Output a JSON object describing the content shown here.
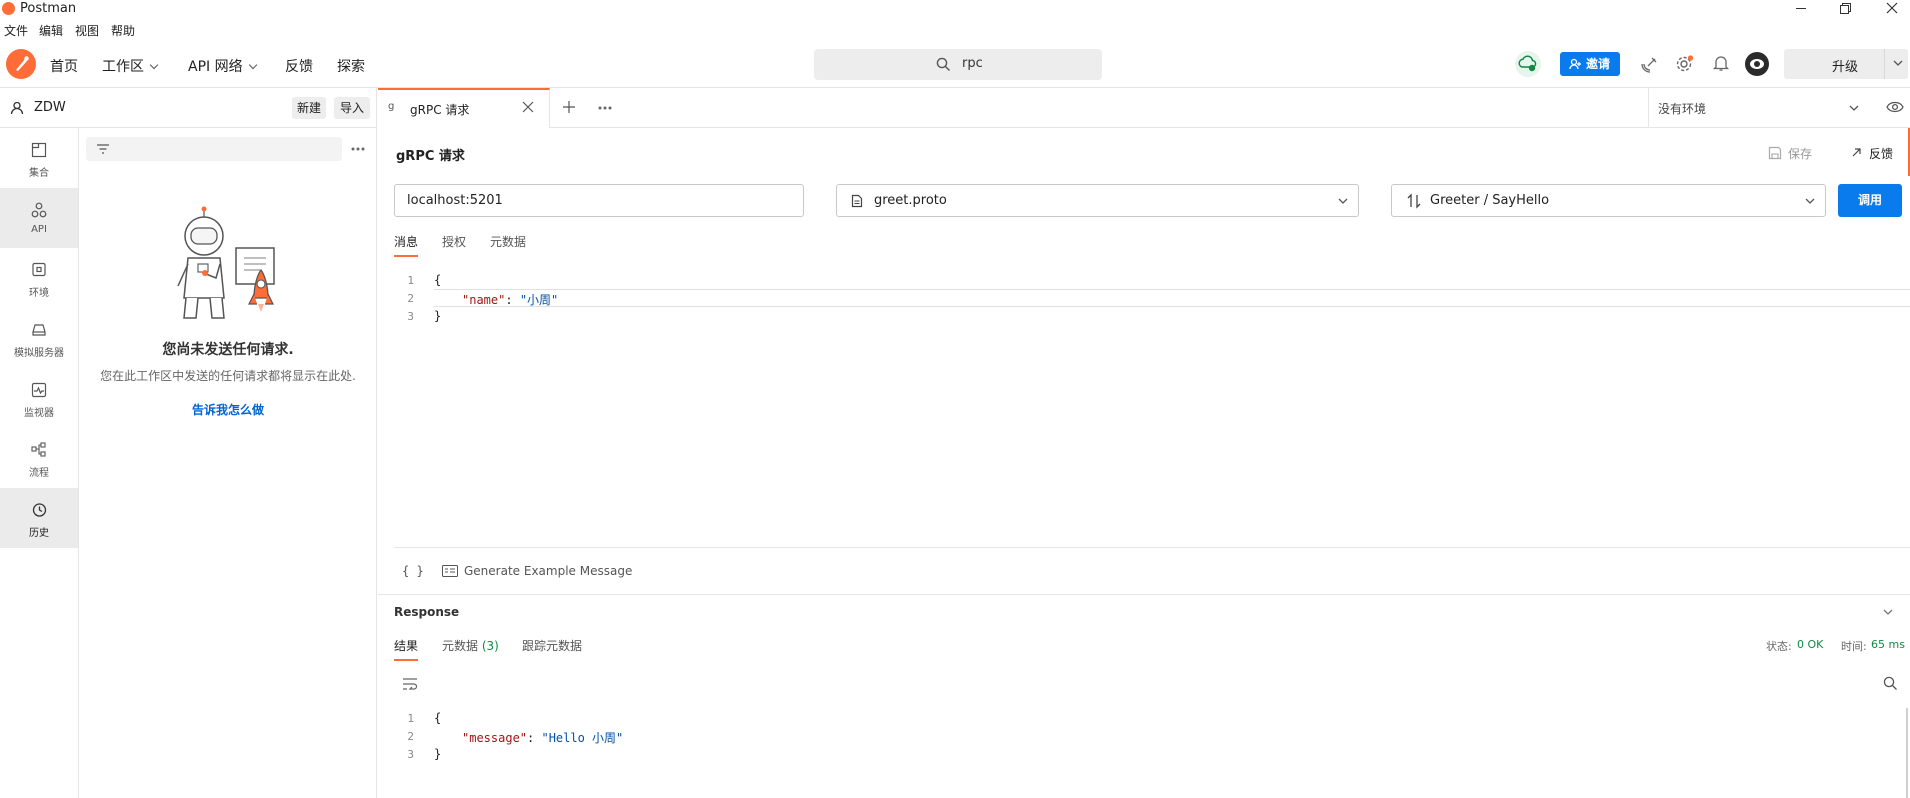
{
  "window": {
    "title": "Postman"
  },
  "menu": [
    "文件",
    "编辑",
    "视图",
    "帮助"
  ],
  "nav": {
    "home": "首页",
    "workspace": "工作区",
    "api_network": "API 网络",
    "feedback": "反馈",
    "explore": "探索"
  },
  "search": {
    "value": "rpc"
  },
  "header": {
    "invite": "邀请",
    "upgrade": "升级"
  },
  "workspace": {
    "name": "ZDW",
    "new_label": "新建",
    "import_label": "导入"
  },
  "rail": [
    {
      "label": "集合",
      "icon": "collections-icon"
    },
    {
      "label": "API",
      "icon": "api-icon"
    },
    {
      "label": "环境",
      "icon": "environment-icon"
    },
    {
      "label": "模拟服务器",
      "icon": "mock-server-icon"
    },
    {
      "label": "监视器",
      "icon": "monitor-icon"
    },
    {
      "label": "流程",
      "icon": "flows-icon"
    },
    {
      "label": "历史",
      "icon": "history-icon"
    }
  ],
  "history": {
    "empty_title": "您尚未发送任何请求.",
    "empty_desc": "您在此工作区中发送的任何请求都将显示在此处.",
    "link": "告诉我怎么做"
  },
  "tab": {
    "label": "gRPC 请求"
  },
  "environment": {
    "selected": "没有环境"
  },
  "request": {
    "title": "gRPC 请求",
    "save_label": "保存",
    "feedback_label": "反馈",
    "url": "localhost:5201",
    "proto": "greet.proto",
    "method": "Greeter / SayHello",
    "invoke_label": "调用",
    "tabs": [
      "消息",
      "授权",
      "元数据"
    ],
    "message_lines": [
      "1",
      "2",
      "3"
    ],
    "message_open": "{",
    "message_key": "\"name\"",
    "message_colon": ": ",
    "message_value": "\"小周\"",
    "message_close": "}",
    "generate_label": "Generate Example Message",
    "braces_label": "{ }"
  },
  "response": {
    "title": "Response",
    "tabs": [
      "结果",
      "元数据",
      "跟踪元数据"
    ],
    "metadata_count": "(3)",
    "status_label": "状态:",
    "status_value": "0 OK",
    "time_label": "时间:",
    "time_value": "65 ms",
    "lines": [
      "1",
      "2",
      "3"
    ],
    "open": "{",
    "key": "\"message\"",
    "colon": ": ",
    "value": "\"Hello 小周\"",
    "close": "}"
  },
  "colors": {
    "accent": "#ff6c37",
    "primary": "#097bed",
    "success": "#0f8a44",
    "link": "#0265d2"
  }
}
